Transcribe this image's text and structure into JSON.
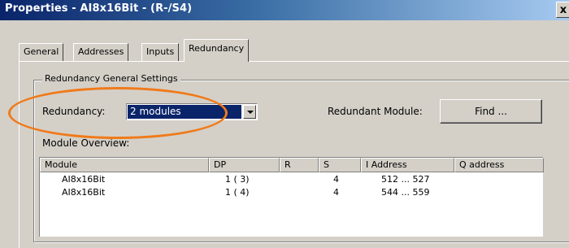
{
  "window": {
    "title": "Properties - AI8x16Bit - (R-/S4)",
    "close_glyph": "x"
  },
  "tabs": [
    {
      "label": "General",
      "active": false
    },
    {
      "label": "Addresses",
      "active": false
    },
    {
      "label": "Inputs",
      "active": false
    },
    {
      "label": "Redundancy",
      "active": true
    }
  ],
  "group": {
    "title": "Redundancy General Settings",
    "redundancy_label": "Redundancy:",
    "redundancy_value": "2 modules",
    "redundant_module_label": "Redundant Module:",
    "find_button": "Find ...",
    "module_overview_label": "Module Overview:"
  },
  "table": {
    "columns": [
      "Module",
      "DP",
      "R",
      "S",
      "I Address",
      "Q address"
    ],
    "rows": [
      [
        "AI8x16Bit",
        "1 ( 3)",
        "",
        "4",
        "512 ...  527",
        ""
      ],
      [
        "AI8x16Bit",
        "1 ( 4)",
        "",
        "4",
        "544 ...  559",
        ""
      ]
    ]
  },
  "colors": {
    "titlebar_start": "#0a246a",
    "titlebar_end": "#a6caf0",
    "dialog_face": "#d4d0c8",
    "selection": "#0a246a",
    "annotation_ellipse": "#f07a1a"
  }
}
